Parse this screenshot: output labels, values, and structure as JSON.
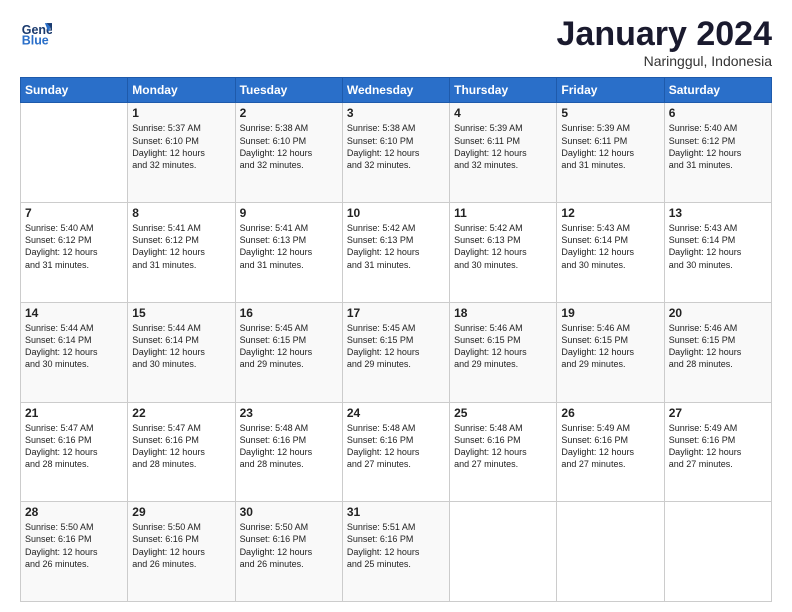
{
  "header": {
    "logo_line1": "General",
    "logo_line2": "Blue",
    "month_title": "January 2024",
    "subtitle": "Naringgul, Indonesia"
  },
  "weekdays": [
    "Sunday",
    "Monday",
    "Tuesday",
    "Wednesday",
    "Thursday",
    "Friday",
    "Saturday"
  ],
  "weeks": [
    [
      {
        "day": "",
        "info": ""
      },
      {
        "day": "1",
        "info": "Sunrise: 5:37 AM\nSunset: 6:10 PM\nDaylight: 12 hours\nand 32 minutes."
      },
      {
        "day": "2",
        "info": "Sunrise: 5:38 AM\nSunset: 6:10 PM\nDaylight: 12 hours\nand 32 minutes."
      },
      {
        "day": "3",
        "info": "Sunrise: 5:38 AM\nSunset: 6:10 PM\nDaylight: 12 hours\nand 32 minutes."
      },
      {
        "day": "4",
        "info": "Sunrise: 5:39 AM\nSunset: 6:11 PM\nDaylight: 12 hours\nand 32 minutes."
      },
      {
        "day": "5",
        "info": "Sunrise: 5:39 AM\nSunset: 6:11 PM\nDaylight: 12 hours\nand 31 minutes."
      },
      {
        "day": "6",
        "info": "Sunrise: 5:40 AM\nSunset: 6:12 PM\nDaylight: 12 hours\nand 31 minutes."
      }
    ],
    [
      {
        "day": "7",
        "info": "Sunrise: 5:40 AM\nSunset: 6:12 PM\nDaylight: 12 hours\nand 31 minutes."
      },
      {
        "day": "8",
        "info": "Sunrise: 5:41 AM\nSunset: 6:12 PM\nDaylight: 12 hours\nand 31 minutes."
      },
      {
        "day": "9",
        "info": "Sunrise: 5:41 AM\nSunset: 6:13 PM\nDaylight: 12 hours\nand 31 minutes."
      },
      {
        "day": "10",
        "info": "Sunrise: 5:42 AM\nSunset: 6:13 PM\nDaylight: 12 hours\nand 31 minutes."
      },
      {
        "day": "11",
        "info": "Sunrise: 5:42 AM\nSunset: 6:13 PM\nDaylight: 12 hours\nand 30 minutes."
      },
      {
        "day": "12",
        "info": "Sunrise: 5:43 AM\nSunset: 6:14 PM\nDaylight: 12 hours\nand 30 minutes."
      },
      {
        "day": "13",
        "info": "Sunrise: 5:43 AM\nSunset: 6:14 PM\nDaylight: 12 hours\nand 30 minutes."
      }
    ],
    [
      {
        "day": "14",
        "info": "Sunrise: 5:44 AM\nSunset: 6:14 PM\nDaylight: 12 hours\nand 30 minutes."
      },
      {
        "day": "15",
        "info": "Sunrise: 5:44 AM\nSunset: 6:14 PM\nDaylight: 12 hours\nand 30 minutes."
      },
      {
        "day": "16",
        "info": "Sunrise: 5:45 AM\nSunset: 6:15 PM\nDaylight: 12 hours\nand 29 minutes."
      },
      {
        "day": "17",
        "info": "Sunrise: 5:45 AM\nSunset: 6:15 PM\nDaylight: 12 hours\nand 29 minutes."
      },
      {
        "day": "18",
        "info": "Sunrise: 5:46 AM\nSunset: 6:15 PM\nDaylight: 12 hours\nand 29 minutes."
      },
      {
        "day": "19",
        "info": "Sunrise: 5:46 AM\nSunset: 6:15 PM\nDaylight: 12 hours\nand 29 minutes."
      },
      {
        "day": "20",
        "info": "Sunrise: 5:46 AM\nSunset: 6:15 PM\nDaylight: 12 hours\nand 28 minutes."
      }
    ],
    [
      {
        "day": "21",
        "info": "Sunrise: 5:47 AM\nSunset: 6:16 PM\nDaylight: 12 hours\nand 28 minutes."
      },
      {
        "day": "22",
        "info": "Sunrise: 5:47 AM\nSunset: 6:16 PM\nDaylight: 12 hours\nand 28 minutes."
      },
      {
        "day": "23",
        "info": "Sunrise: 5:48 AM\nSunset: 6:16 PM\nDaylight: 12 hours\nand 28 minutes."
      },
      {
        "day": "24",
        "info": "Sunrise: 5:48 AM\nSunset: 6:16 PM\nDaylight: 12 hours\nand 27 minutes."
      },
      {
        "day": "25",
        "info": "Sunrise: 5:48 AM\nSunset: 6:16 PM\nDaylight: 12 hours\nand 27 minutes."
      },
      {
        "day": "26",
        "info": "Sunrise: 5:49 AM\nSunset: 6:16 PM\nDaylight: 12 hours\nand 27 minutes."
      },
      {
        "day": "27",
        "info": "Sunrise: 5:49 AM\nSunset: 6:16 PM\nDaylight: 12 hours\nand 27 minutes."
      }
    ],
    [
      {
        "day": "28",
        "info": "Sunrise: 5:50 AM\nSunset: 6:16 PM\nDaylight: 12 hours\nand 26 minutes."
      },
      {
        "day": "29",
        "info": "Sunrise: 5:50 AM\nSunset: 6:16 PM\nDaylight: 12 hours\nand 26 minutes."
      },
      {
        "day": "30",
        "info": "Sunrise: 5:50 AM\nSunset: 6:16 PM\nDaylight: 12 hours\nand 26 minutes."
      },
      {
        "day": "31",
        "info": "Sunrise: 5:51 AM\nSunset: 6:16 PM\nDaylight: 12 hours\nand 25 minutes."
      },
      {
        "day": "",
        "info": ""
      },
      {
        "day": "",
        "info": ""
      },
      {
        "day": "",
        "info": ""
      }
    ]
  ]
}
